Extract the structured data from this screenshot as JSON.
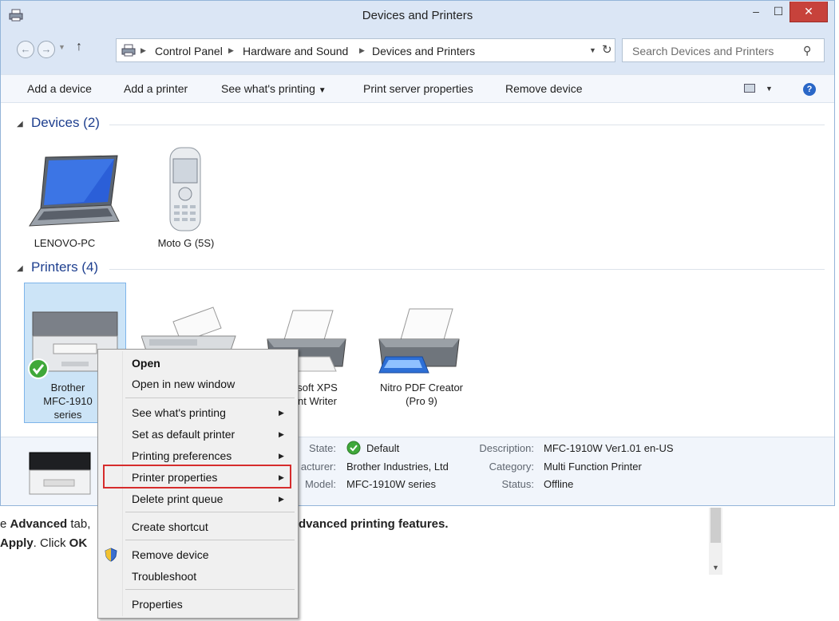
{
  "window": {
    "title": "Devices and Printers",
    "close_glyph": "✕",
    "min_glyph": "–",
    "max_glyph": "☐"
  },
  "nav": {
    "back_glyph": "←",
    "forward_glyph": "→",
    "up_glyph": "↑",
    "breadcrumb": [
      "Control Panel",
      "Hardware and Sound",
      "Devices and Printers"
    ],
    "search_placeholder": "Search Devices and Printers"
  },
  "toolbar": {
    "add_device": "Add a device",
    "add_printer": "Add a printer",
    "see_printing": "See what's printing",
    "print_server": "Print server properties",
    "remove_device": "Remove device",
    "help_glyph": "?"
  },
  "groups": {
    "devices": "Devices (2)",
    "printers": "Printers (4)"
  },
  "devices": [
    "LENOVO-PC",
    "Moto G (5S)"
  ],
  "printers": {
    "brother_l1": "Brother",
    "brother_l2": "MFC-1910",
    "brother_l3": "series",
    "xps_l1": "osoft XPS",
    "xps_l2": "ment Writer",
    "nitro_l1": "Nitro PDF Creator",
    "nitro_l2": "(Pro 9)"
  },
  "details": {
    "state_label": "State:",
    "state_value": "Default",
    "manufacturer_label": "acturer:",
    "manufacturer_value": "Brother Industries, Ltd",
    "model_label": "Model:",
    "model_value": "MFC-1910W series",
    "description_label": "Description:",
    "description_value": "MFC-1910W Ver1.01 en-US",
    "category_label": "Category:",
    "category_value": "Multi Function Printer",
    "status_label": "Status:",
    "status_value": "Offline"
  },
  "context_menu": {
    "open": "Open",
    "open_new_window": "Open in new window",
    "see_printing": "See what's printing",
    "set_default": "Set as default printer",
    "printing_prefs": "Printing preferences",
    "printer_props": "Printer properties",
    "delete_queue": "Delete print queue",
    "create_shortcut": "Create shortcut",
    "remove_device": "Remove device",
    "troubleshoot": "Troubleshoot",
    "properties": "Properties"
  },
  "background_page": {
    "line1_a": "e ",
    "line1_b": "Advanced",
    "line1_c": " tab,",
    "line1_d": "dvanced printing features",
    "line2_a": "Apply",
    "line2_b": ". Click ",
    "line2_c": "OK"
  },
  "colors": {
    "accent_title": "#1e3f8f",
    "selection": "#cce4f7",
    "highlight_box": "#d62c2c",
    "close_button": "#c7423b"
  }
}
